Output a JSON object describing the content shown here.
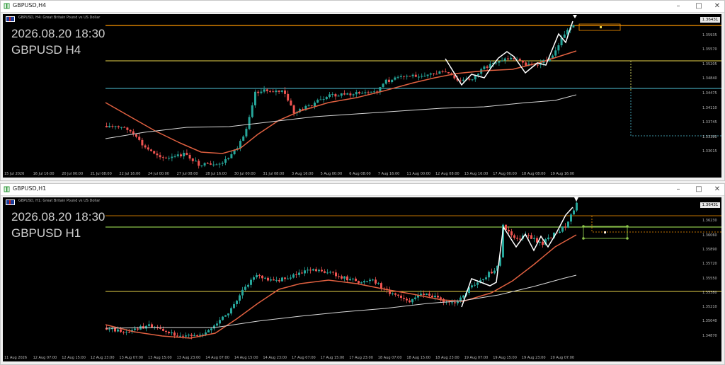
{
  "colors": {
    "bull": "#26a69a",
    "bear": "#ef5350",
    "orange": "#ff9800",
    "yellow": "#e8d34a",
    "cyan": "#4fc3d9",
    "ma": "#e06040",
    "ma_slow": "#d8d8d8",
    "zigzag": "#ffffff",
    "green": "#8bc34a"
  },
  "windows": [
    {
      "title": "GBPUSD,H4",
      "chart_label": "GBPUSD, H4:  Great Britain Pound vs US Dollar",
      "overlay_time": "2026.08.20 18:30",
      "overlay_symbol": "GBPUSD H4",
      "current_price": "1.36431",
      "y_ticks": [
        "1.36300",
        "1.35935",
        "1.35570",
        "1.35205",
        "1.34840",
        "1.34475",
        "1.34110",
        "1.33745",
        "1.33380",
        "1.33015"
      ],
      "x_ticks": [
        "15 Jul 2026",
        "16 Jul 16:00",
        "20 Jul 00:00",
        "21 Jul 08:00",
        "22 Jul 16:00",
        "24 Jul 00:00",
        "27 Jul 08:00",
        "28 Jul 16:00",
        "30 Jul 00:00",
        "31 Jul 08:00",
        "3 Aug 16:00",
        "5 Aug 00:00",
        "6 Aug 08:00",
        "7 Aug 16:00",
        "11 Aug 00:00",
        "12 Aug 08:00",
        "13 Aug 16:00",
        "17 Aug 00:00",
        "18 Aug 08:00",
        "19 Aug 16:00"
      ]
    },
    {
      "title": "GBPUSD,H1",
      "chart_label": "GBPUSD, H1:  Great Britain Pound vs US Dollar",
      "overlay_time": "2026.08.20 18:30",
      "overlay_symbol": "GBPUSD H1",
      "current_price": "1.36431",
      "y_ticks": [
        "1.36400",
        "1.36230",
        "1.36060",
        "1.35890",
        "1.35720",
        "1.35550",
        "1.35380",
        "1.35210",
        "1.35040",
        "1.34870"
      ],
      "x_ticks": [
        "11 Aug 2026",
        "12 Aug 07:00",
        "12 Aug 15:00",
        "12 Aug 23:00",
        "13 Aug 07:00",
        "13 Aug 15:00",
        "13 Aug 23:00",
        "14 Aug 07:00",
        "14 Aug 15:00",
        "14 Aug 23:00",
        "17 Aug 07:00",
        "17 Aug 15:00",
        "17 Aug 23:00",
        "18 Aug 07:00",
        "18 Aug 15:00",
        "18 Aug 23:00",
        "19 Aug 07:00",
        "19 Aug 15:00",
        "19 Aug 23:00",
        "20 Aug 07:00"
      ]
    }
  ],
  "icons": {
    "app": "chart-window-icon",
    "minimize": "minimize-icon",
    "maximize": "maximize-icon",
    "close": "close-icon"
  }
}
